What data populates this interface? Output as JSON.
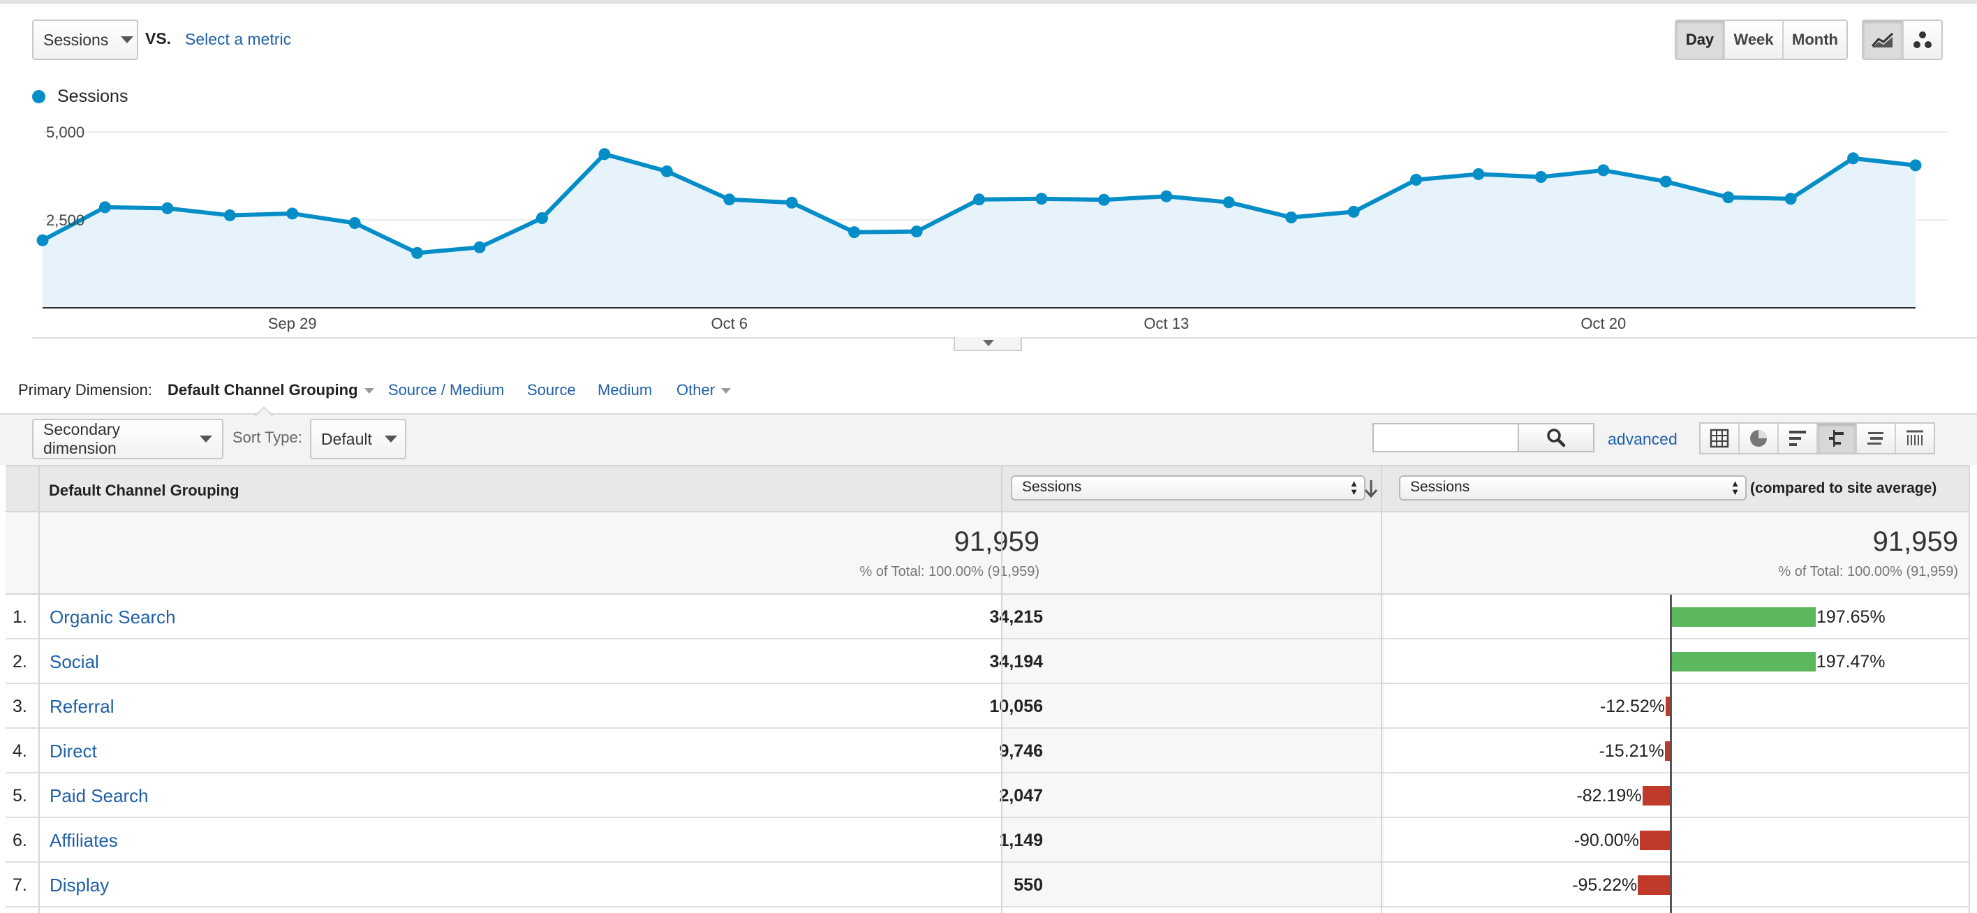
{
  "metric_selector": {
    "primary_metric": "Sessions",
    "vs_label": "VS.",
    "select_metric_link": "Select a metric"
  },
  "granularity": {
    "options": [
      "Day",
      "Week",
      "Month"
    ],
    "active": "Day"
  },
  "chart_view_icons": [
    "line-chart-icon",
    "motion-chart-icon"
  ],
  "chart_data": {
    "type": "area",
    "title": "",
    "legend": [
      {
        "name": "Sessions",
        "color": "#058dc7"
      }
    ],
    "legend_placement": "top-left",
    "x_tick_labels": [
      "Sep 29",
      "Oct 6",
      "Oct 13",
      "Oct 20"
    ],
    "x_start": "Sep 25",
    "x_end": "Oct 25",
    "y_tick_labels": [
      "5,000",
      "2,500"
    ],
    "ylim": [
      0,
      5000
    ],
    "grid": true,
    "series": [
      {
        "name": "Sessions",
        "color": "#058dc7",
        "values": [
          1920,
          2860,
          2830,
          2630,
          2680,
          2410,
          1560,
          1720,
          2550,
          4370,
          3880,
          3080,
          2990,
          2150,
          2170,
          3080,
          3100,
          3070,
          3170,
          3000,
          2570,
          2730,
          3640,
          3800,
          3720,
          3910,
          3590,
          3140,
          3100,
          4250,
          4050
        ]
      }
    ]
  },
  "primary_dimension": {
    "label": "Primary Dimension:",
    "active": "Default Channel Grouping",
    "options": [
      "Source / Medium",
      "Source",
      "Medium",
      "Other"
    ]
  },
  "toolbar": {
    "secondary_dimension": "Secondary dimension",
    "sort_type_label": "Sort Type:",
    "sort_type_value": "Default",
    "search_value": "",
    "advanced_link": "advanced",
    "view_icons": [
      "data-table-icon",
      "pie-chart-icon",
      "performance-icon",
      "comparison-icon",
      "term-cloud-icon",
      "pivot-icon"
    ],
    "active_view": "comparison-icon"
  },
  "table": {
    "dimension_header": "Default Channel Grouping",
    "metric_1": "Sessions",
    "metric_2": "Sessions",
    "compare_header": "(compared to site average)",
    "totals": {
      "value": "91,959",
      "percent_label": "% of Total: 100.00% (91,959)",
      "compare_value": "91,959",
      "compare_percent_label": "% of Total: 100.00% (91,959)"
    },
    "rows": [
      {
        "index": "1.",
        "name": "Organic Search",
        "sessions": "34,215",
        "compare": "197.65%",
        "compare_value": 197.65
      },
      {
        "index": "2.",
        "name": "Social",
        "sessions": "34,194",
        "compare": "197.47%",
        "compare_value": 197.47
      },
      {
        "index": "3.",
        "name": "Referral",
        "sessions": "10,056",
        "compare": "-12.52%",
        "compare_value": -12.52
      },
      {
        "index": "4.",
        "name": "Direct",
        "sessions": "9,746",
        "compare": "-15.21%",
        "compare_value": -15.21
      },
      {
        "index": "5.",
        "name": "Paid Search",
        "sessions": "2,047",
        "compare": "-82.19%",
        "compare_value": -82.19
      },
      {
        "index": "6.",
        "name": "Affiliates",
        "sessions": "1,149",
        "compare": "-90.00%",
        "compare_value": -90.0
      },
      {
        "index": "7.",
        "name": "Display",
        "sessions": "550",
        "compare": "-95.22%",
        "compare_value": -95.22
      }
    ],
    "positive_color": "#5cb85c",
    "negative_color": "#c0392b"
  },
  "colors": {
    "accent": "#058dc7",
    "link": "#1e5fa7",
    "area_fill": "#e6f3fa"
  }
}
